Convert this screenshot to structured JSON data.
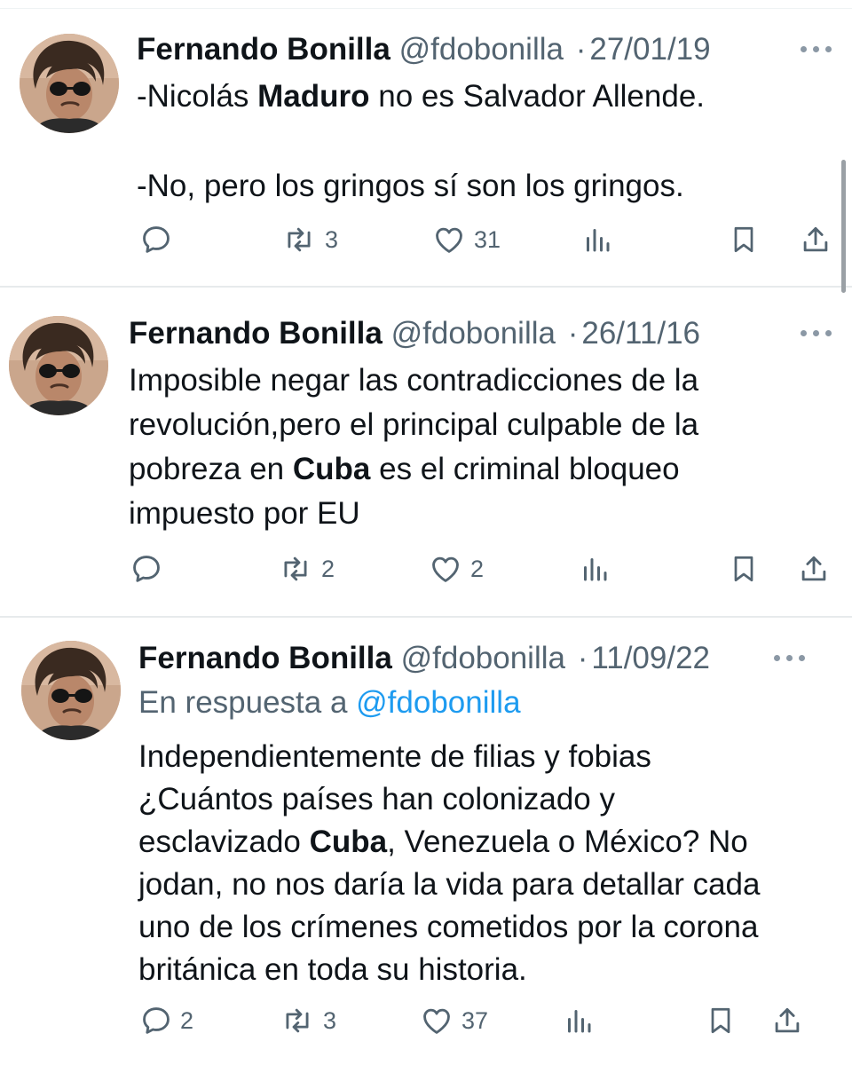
{
  "tweets": [
    {
      "name": "Fernando Bonilla",
      "handle": "@fdobonilla",
      "separator": "·",
      "date": "27/01/19",
      "line1_pre": "-Nicolás ",
      "line1_bold": "Maduro",
      "line1_post": " no es Salvador Allende.",
      "line2": "-No, pero los gringos sí son los gringos.",
      "replies": "",
      "retweets": "3",
      "likes": "31"
    },
    {
      "name": "Fernando Bonilla",
      "handle": "@fdobonilla",
      "separator": "·",
      "date": "26/11/16",
      "line1": "Imposible negar las contradicciones de la",
      "line2": "revolución,pero el principal culpable de la",
      "line3_pre": "pobreza en ",
      "line3_bold": "Cuba",
      "line3_post": " es el criminal bloqueo",
      "line4": "impuesto por EU",
      "replies": "",
      "retweets": "2",
      "likes": "2"
    },
    {
      "name": "Fernando Bonilla",
      "handle": "@fdobonilla",
      "separator": "·",
      "date": "11/09/22",
      "reply_prefix": "En respuesta a ",
      "reply_mention": "@fdobonilla",
      "line1": "Independientemente de filias y fobias",
      "line2": "¿Cuántos países han colonizado y",
      "line3_pre": "esclavizado ",
      "line3_bold": "Cuba",
      "line3_post": ", Venezuela o México? No",
      "line4": "jodan, no nos daría la vida para detallar cada",
      "line5": "uno de los crímenes cometidos por la corona",
      "line6": "británica en toda su historia.",
      "replies": "2",
      "retweets": "3",
      "likes": "37"
    }
  ],
  "icons": {
    "reply": "speech-bubble",
    "retweet": "retweet-arrows",
    "like": "heart",
    "views": "bar-chart",
    "bookmark": "bookmark",
    "share": "share-arrow-up",
    "more": "three-dots"
  },
  "colors": {
    "text": "#0f1419",
    "secondary": "#536471",
    "link": "#1d9bf0",
    "divider": "#e7eaec"
  }
}
